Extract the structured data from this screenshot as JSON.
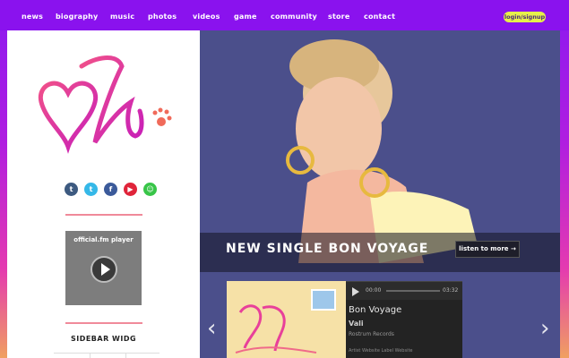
{
  "nav": {
    "items": [
      "news",
      "biography",
      "music",
      "photos",
      "videos",
      "game",
      "community",
      "store",
      "contact"
    ],
    "login": "login/signup"
  },
  "sidebar": {
    "logo_text": "Vali",
    "social_icons": [
      "tumblr-icon",
      "twitter-icon",
      "facebook-icon",
      "youtube-icon",
      "chat-icon"
    ],
    "player_title": "official.fm player",
    "widget_title": "SIDEBAR WIDG"
  },
  "hero": {
    "title": "NEW SINGLE BON VOYAGE",
    "listen_label": "listen to   more →",
    "prev_icon": "chevron-left-icon",
    "next_icon": "chevron-right-icon"
  },
  "player": {
    "time_start": "00:00",
    "time_end": "03:32",
    "song": "Bon Voyage",
    "artist": "Vali",
    "label": "Rostrum Records",
    "links": "Artist Website   Label Website"
  },
  "colors": {
    "topbar": "#8a12ee",
    "accent": "#e6f04a",
    "logo_pink": "#e8409a"
  }
}
